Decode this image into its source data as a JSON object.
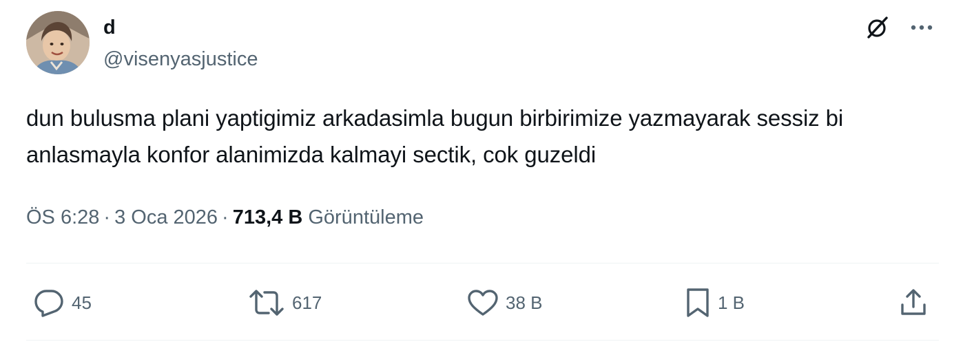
{
  "author": {
    "display_name": "d",
    "handle": "@visenyasjustice",
    "avatar_icon": "child-portrait-avatar"
  },
  "header_actions": {
    "grok_icon": "grok-icon",
    "more_icon": "more-horizontal-icon"
  },
  "tweet": {
    "text": "dun bulusma plani yaptigimiz arkadasimla bugun birbirimize yazmayarak sessiz bi anlasmayla konfor alanimizda kalmayi sectik, cok guzeldi"
  },
  "meta": {
    "time": "ÖS 6:28",
    "separator": "·",
    "date": "3 Oca 2026",
    "views_count": "713,4 B",
    "views_label": "Görüntüleme"
  },
  "actions": {
    "replies": "45",
    "reposts": "617",
    "likes": "38 B",
    "bookmarks": "1 B"
  },
  "colors": {
    "text_primary": "#0f1419",
    "text_secondary": "#536471",
    "divider": "#eff3f4"
  }
}
